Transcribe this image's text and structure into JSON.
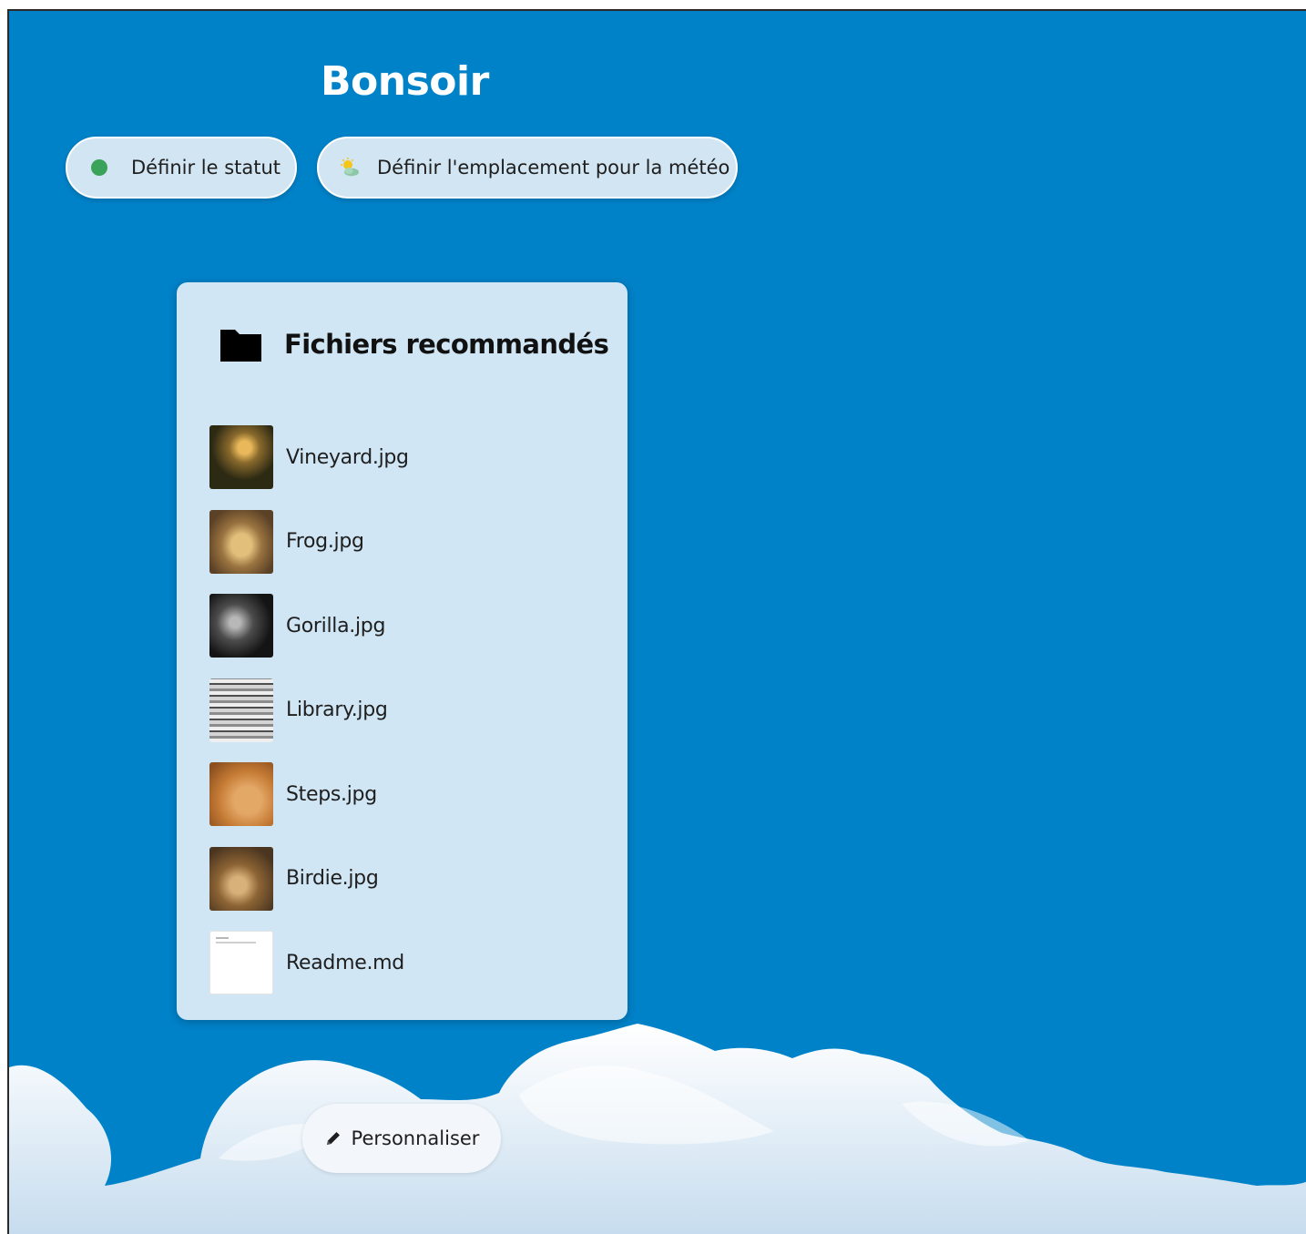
{
  "greeting": "Bonsoir",
  "status_button": {
    "label": "Définir le statut",
    "icon": "green-dot-icon"
  },
  "weather_button": {
    "label": "Définir l'emplacement pour la météo",
    "icon": "sun-cloud-icon"
  },
  "recommended_files": {
    "title": "Fichiers recommandés",
    "icon": "folder-icon",
    "items": [
      {
        "name": "Vineyard.jpg"
      },
      {
        "name": "Frog.jpg"
      },
      {
        "name": "Gorilla.jpg"
      },
      {
        "name": "Library.jpg"
      },
      {
        "name": "Steps.jpg"
      },
      {
        "name": "Birdie.jpg"
      },
      {
        "name": "Readme.md"
      }
    ]
  },
  "customize_button": {
    "label": "Personnaliser",
    "icon": "pencil-icon"
  },
  "colors": {
    "background": "#0082c9",
    "card": "#d0e6f4",
    "pill": "#d2e5f2",
    "status_dot": "#3aa35a"
  }
}
